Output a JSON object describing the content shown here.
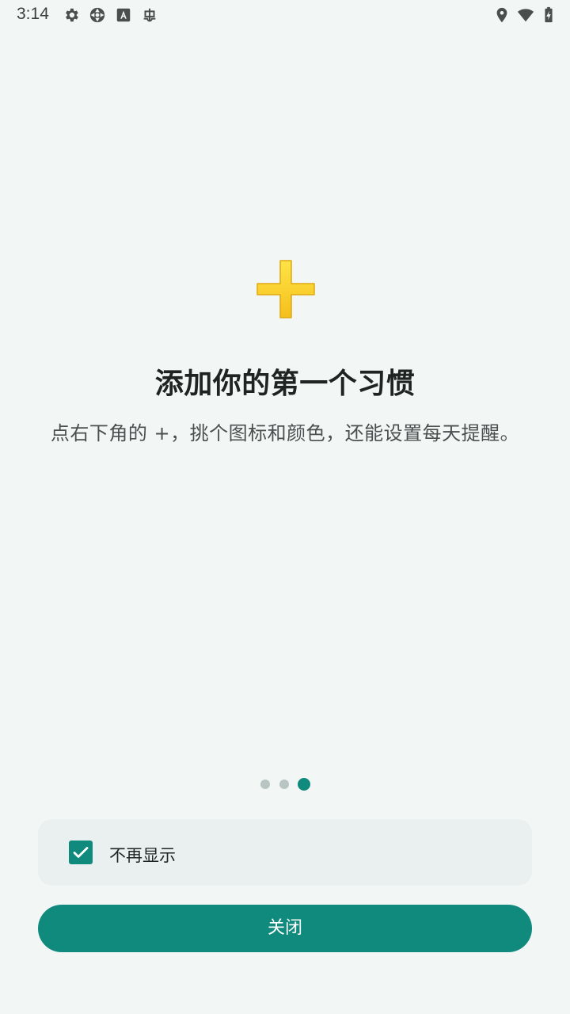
{
  "status_bar": {
    "time": "3:14",
    "left_icons": [
      "gear-icon",
      "aperture-icon",
      "font-badge-icon",
      "bug-icon"
    ],
    "right_icons": [
      "location-pin-icon",
      "wifi-icon",
      "battery-charging-icon"
    ]
  },
  "onboarding": {
    "hero_icon": "plus-icon",
    "title": "添加你的第一个习惯",
    "subtitle": "点右下角的 +，挑个图标和颜色，还能设置每天提醒。",
    "pager": {
      "total_pages": 3,
      "current_page": 3
    }
  },
  "preferences": {
    "dont_show_again_label": "不再显示",
    "dont_show_again_checked": true
  },
  "actions": {
    "close_label": "关闭"
  },
  "colors": {
    "accent": "#0f8a7c",
    "background": "#f2f6f5",
    "card_background": "#eaf0f0",
    "dot_inactive": "#b9c5c3",
    "plus_fill": "#fbd73a"
  }
}
